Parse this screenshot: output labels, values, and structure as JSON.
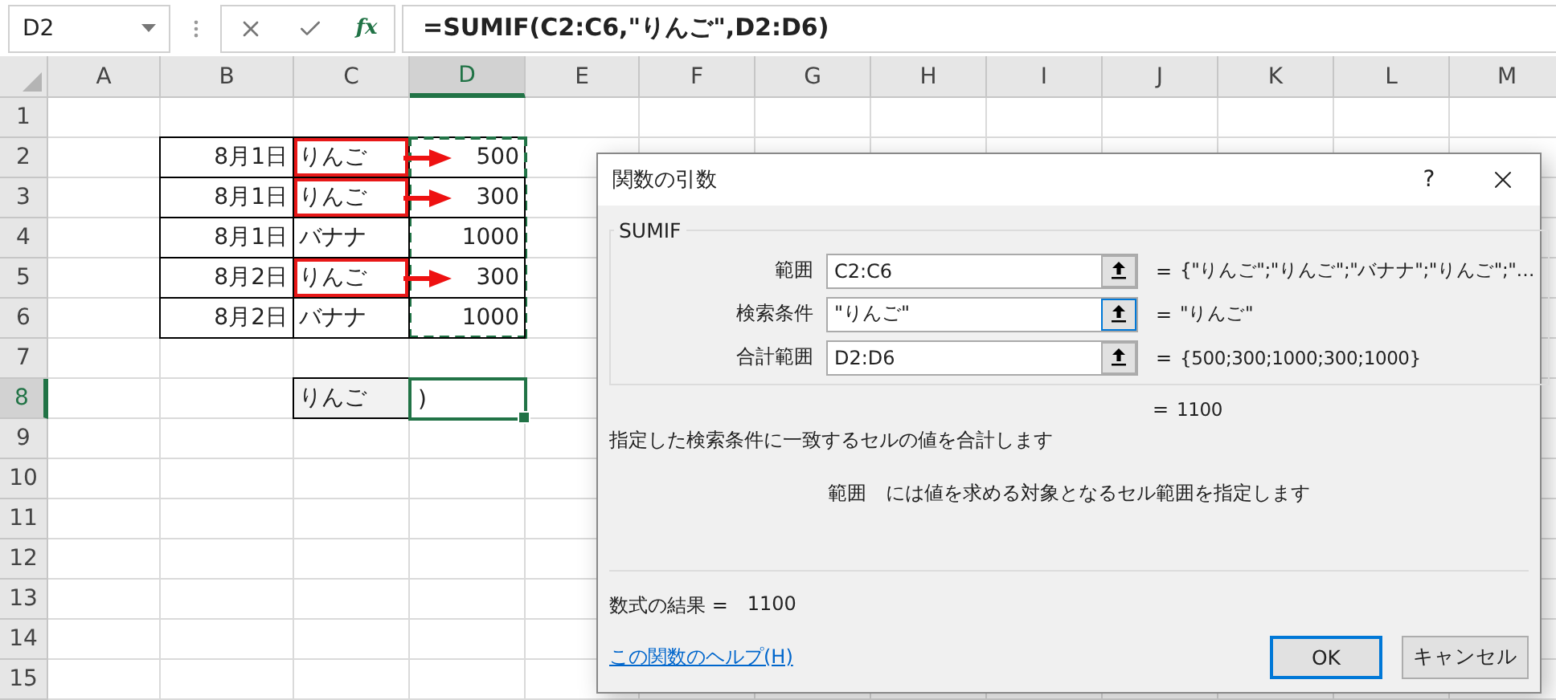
{
  "name_box": {
    "value": "D2"
  },
  "formula_bar": {
    "function_label": "fx",
    "formula": "=SUMIF(C2:C6,\"りんご\",D2:D6)"
  },
  "sheet": {
    "columns": [
      {
        "label": "A",
        "selected": false
      },
      {
        "label": "B",
        "selected": false
      },
      {
        "label": "C",
        "selected": false
      },
      {
        "label": "D",
        "selected": true
      },
      {
        "label": "E",
        "selected": false
      },
      {
        "label": "F",
        "selected": false
      },
      {
        "label": "G",
        "selected": false
      },
      {
        "label": "H",
        "selected": false
      },
      {
        "label": "I",
        "selected": false
      },
      {
        "label": "J",
        "selected": false
      },
      {
        "label": "K",
        "selected": false
      },
      {
        "label": "L",
        "selected": false
      },
      {
        "label": "M",
        "selected": false
      }
    ],
    "rows": [
      {
        "number": "1",
        "selected": false
      },
      {
        "number": "2",
        "selected": false,
        "date": "8月1日",
        "item": "りんご",
        "amount": "500",
        "matched": true,
        "in_sum_range": true
      },
      {
        "number": "3",
        "selected": false,
        "date": "8月1日",
        "item": "りんご",
        "amount": "300",
        "matched": true,
        "in_sum_range": true
      },
      {
        "number": "4",
        "selected": false,
        "date": "8月1日",
        "item": "バナナ",
        "amount": "1000",
        "matched": false,
        "in_sum_range": true
      },
      {
        "number": "5",
        "selected": false,
        "date": "8月2日",
        "item": "りんご",
        "amount": "300",
        "matched": true,
        "in_sum_range": true
      },
      {
        "number": "6",
        "selected": false,
        "date": "8月2日",
        "item": "バナナ",
        "amount": "1000",
        "matched": false,
        "in_sum_range": true
      },
      {
        "number": "7",
        "selected": false
      },
      {
        "number": "8",
        "selected": true,
        "criteria": "りんご",
        "editing": ")"
      },
      {
        "number": "9",
        "selected": false
      },
      {
        "number": "10",
        "selected": false
      },
      {
        "number": "11",
        "selected": false
      },
      {
        "number": "12",
        "selected": false
      },
      {
        "number": "13",
        "selected": false
      },
      {
        "number": "14",
        "selected": false
      },
      {
        "number": "15",
        "selected": false
      }
    ]
  },
  "dialog": {
    "title": "関数の引数",
    "help": "?",
    "function_name": "SUMIF",
    "arguments": [
      {
        "label": "範囲",
        "value": "C2:C6",
        "result": "{\"りんご\";\"りんご\";\"バナナ\";\"りんご\";\"…",
        "focused": false
      },
      {
        "label": "検索条件",
        "value": "\"りんご\"",
        "result": "\"りんご\"",
        "focused": true
      },
      {
        "label": "合計範囲",
        "value": "D2:D6",
        "result": "{500;300;1000;300;1000}",
        "focused": false
      }
    ],
    "equals": "=",
    "function_result": "1100",
    "description": "指定した検索条件に一致するセルの値を合計します",
    "argument_name": "範囲",
    "argument_description": "には値を求める対象となるセル範囲を指定します",
    "formula_result_label": "数式の結果 =",
    "formula_result": "1100",
    "help_link": "この関数のヘルプ(H)",
    "buttons": [
      {
        "label": "OK",
        "default": true
      },
      {
        "label": "キャンセル",
        "default": false
      }
    ]
  }
}
